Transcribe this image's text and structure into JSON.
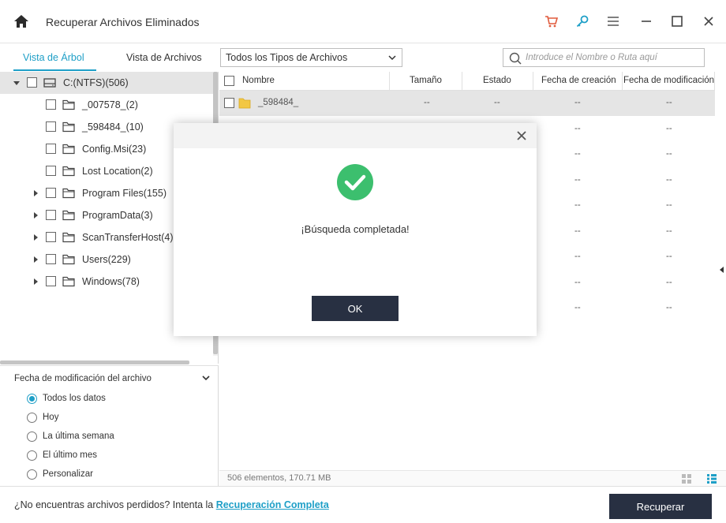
{
  "app": {
    "title": "Recuperar Archivos Eliminados"
  },
  "titlebar_icons": [
    "home-icon",
    "cart-icon",
    "key-icon",
    "menu-icon",
    "minimize-icon",
    "maximize-icon",
    "close-icon"
  ],
  "tabs": {
    "tree_view": "Vista de Árbol",
    "file_view": "Vista de Archivos"
  },
  "filter": {
    "type_select": "Todos los Tipos de Archivos"
  },
  "search": {
    "placeholder": "Introduce el Nombre o Ruta aquí"
  },
  "tree": {
    "root": "C:(NTFS)(506)",
    "items": [
      {
        "label": "_007578_(2)",
        "expandable": false
      },
      {
        "label": "_598484_(10)",
        "expandable": false
      },
      {
        "label": "Config.Msi(23)",
        "expandable": false
      },
      {
        "label": "Lost Location(2)",
        "expandable": false
      },
      {
        "label": "Program Files(155)",
        "expandable": true
      },
      {
        "label": "ProgramData(3)",
        "expandable": true
      },
      {
        "label": "ScanTransferHost(4)",
        "expandable": true
      },
      {
        "label": "Users(229)",
        "expandable": true
      },
      {
        "label": "Windows(78)",
        "expandable": true
      }
    ]
  },
  "date_filter": {
    "title": "Fecha de modificación del archivo",
    "options": [
      "Todos los datos",
      "Hoy",
      "La última semana",
      "El último mes",
      "Personalizar"
    ],
    "selected": "Todos los datos"
  },
  "list": {
    "columns": [
      "Nombre",
      "Tamaño",
      "Estado",
      "Fecha de creación",
      "Fecha de modificación"
    ],
    "first_row": {
      "name": "_598484_",
      "size": "--",
      "state": "--",
      "created": "--",
      "modified": "--"
    },
    "placeholder": "--"
  },
  "status": {
    "summary": "506 elementos, 170.71 MB"
  },
  "bottom": {
    "prompt": "¿No encuentras archivos perdidos? Intenta la ",
    "link": "Recuperación Completa",
    "recover_button": "Recuperar"
  },
  "modal": {
    "message": "¡Búsqueda completada!",
    "ok_button": "OK"
  },
  "colors": {
    "accent": "#1e9fc7",
    "button_dark": "#283042",
    "success": "#3cbf6e",
    "cart": "#e05a3c"
  }
}
